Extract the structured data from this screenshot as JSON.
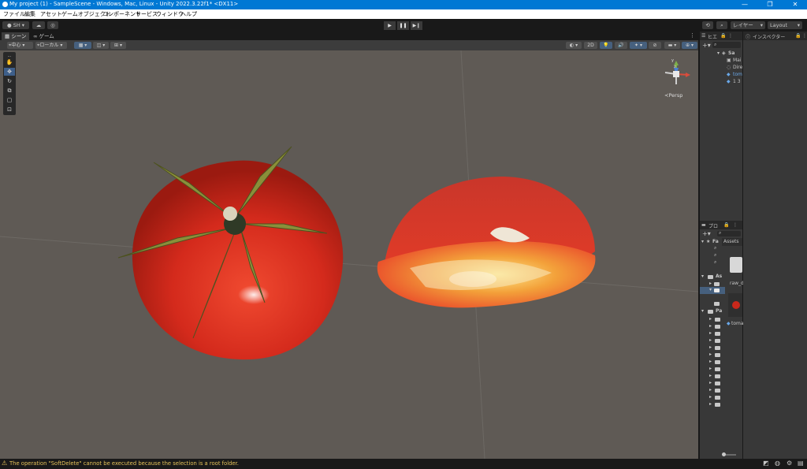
{
  "window": {
    "title": "My project (1) - SampleScene - Windows, Mac, Linux - Unity 2022.3.22f1* <DX11>",
    "minimize": "—",
    "maximize": "❐",
    "close": "✕"
  },
  "menu": [
    "ファイル",
    "編集",
    "アセット",
    "ゲームオブジェクト",
    "コンポーネント",
    "サービス",
    "ウィンドウ",
    "ヘルプ"
  ],
  "toolbar": {
    "account_label": "SH ▾",
    "layers_label": "レイヤー",
    "layout_label": "Layout"
  },
  "scene_tabs": {
    "scene": "シーン",
    "game": "ゲーム"
  },
  "scene_toolbar": {
    "pivot": "中心",
    "space": "ローカル",
    "mode_2d": "2D"
  },
  "gizmo": {
    "y": "y",
    "z": "z",
    "persp": "Persp"
  },
  "hierarchy": {
    "tab_label": "ヒエ",
    "scene_name": "Sa",
    "items": [
      "Mai",
      "Dire",
      "tom",
      "1 3"
    ]
  },
  "project": {
    "tab_label": "プロ",
    "favorites": "Fa",
    "assets_crumb": "Assets",
    "assets_root": "As",
    "packages": "Pa",
    "file1": "raw_d",
    "file2": "toma"
  },
  "inspector": {
    "tab_label": "インスペクター"
  },
  "status": {
    "message": "The operation \"SoftDelete\" cannot be executed because the selection is a root folder.",
    "warning_color": "#e6c35a"
  },
  "colors": {
    "title_bar": "#0078d4",
    "viewport_bg": "#5f5a55",
    "tomato_red": "#d42a1c",
    "selection_blue": "#3e5f8a"
  }
}
